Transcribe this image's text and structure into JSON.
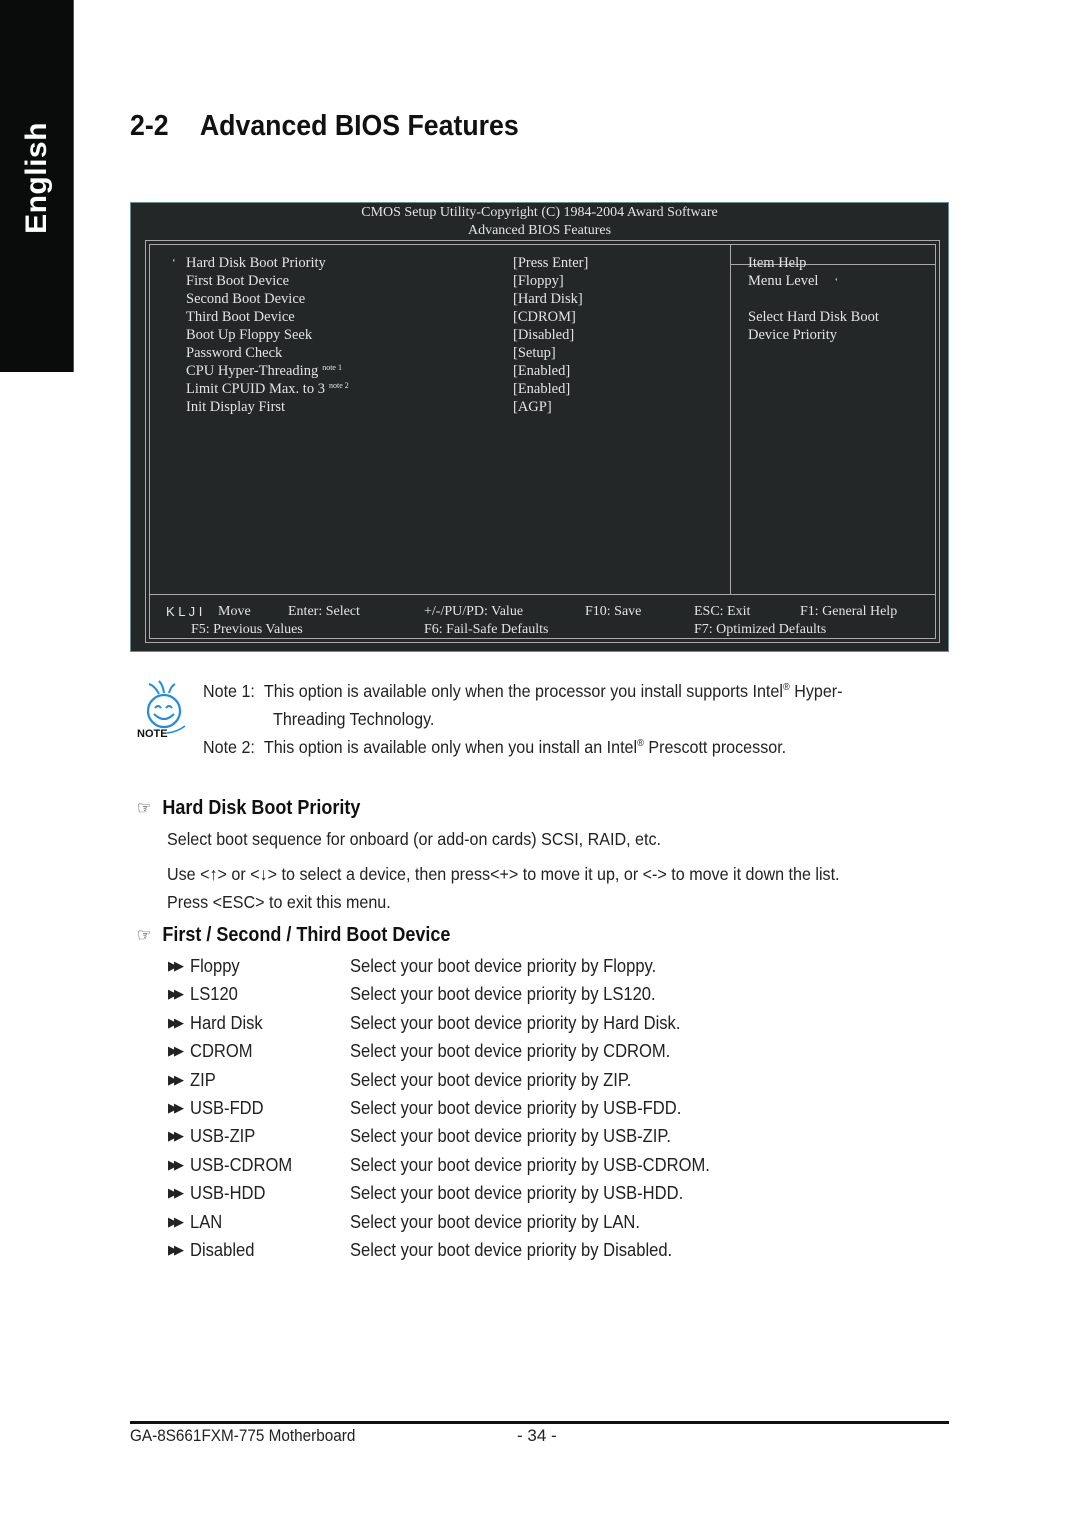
{
  "side_tab": {
    "label": "English"
  },
  "section": {
    "number": "2-2",
    "title": "Advanced BIOS Features"
  },
  "bios": {
    "header_line1": "CMOS Setup Utility-Copyright (C) 1984-2004 Award Software",
    "header_line2": "Advanced BIOS Features",
    "items": [
      {
        "marker": "‘",
        "label": "Hard Disk Boot Priority",
        "note": "",
        "value": "[Press Enter]"
      },
      {
        "marker": "",
        "label": "First Boot Device",
        "note": "",
        "value": "[Floppy]"
      },
      {
        "marker": "",
        "label": "Second Boot Device",
        "note": "",
        "value": "[Hard Disk]"
      },
      {
        "marker": "",
        "label": "Third Boot Device",
        "note": "",
        "value": "[CDROM]"
      },
      {
        "marker": "",
        "label": "Boot Up Floppy Seek",
        "note": "",
        "value": "[Disabled]"
      },
      {
        "marker": "",
        "label": "Password Check",
        "note": "",
        "value": "[Setup]"
      },
      {
        "marker": "",
        "label": "CPU  Hyper-Threading",
        "note": "note 1",
        "value": "[Enabled]"
      },
      {
        "marker": "",
        "label": "Limit CPUID Max. to 3",
        "note": "note 2",
        "value": "[Enabled]"
      },
      {
        "marker": "",
        "label": "Init Display First",
        "note": "",
        "value": "[AGP]"
      }
    ],
    "help": {
      "title": "Item Help",
      "menu_level": "Menu Level",
      "menu_level_marker": "‘",
      "line1": "Select Hard Disk Boot",
      "line2": "Device  Priority"
    },
    "keys": {
      "arrows": "K L J I",
      "move": "Move",
      "enter": "Enter: Select",
      "value": "+/-/PU/PD: Value",
      "save": "F10: Save",
      "exit": "ESC: Exit",
      "help": "F1: General Help",
      "previous": "F5: Previous Values",
      "failsafe": "F6: Fail-Safe Defaults",
      "optimized": "F7: Optimized Defaults"
    }
  },
  "notes": {
    "icon_label": "NOTE",
    "note1_prefix": "Note 1:",
    "note1_text": "This option is available only when the processor you install supports Intel",
    "note1_text_after": " Hyper-",
    "note1_cont": "Threading Technology.",
    "note2_prefix": "Note 2:",
    "note2_text": "This option is available only when you install an Intel",
    "note2_text_after": " Prescott processor.",
    "registered": "®"
  },
  "hard_disk": {
    "heading": "Hard Disk Boot Priority",
    "para1": "Select boot sequence for onboard (or add-on cards) SCSI, RAID, etc.",
    "para2": "Use <↑> or <↓> to select a device, then press<+> to move it up, or <-> to move it down the list.",
    "para3": "Press <ESC> to exit this menu."
  },
  "boot_device": {
    "heading": "First / Second / Third Boot Device",
    "options": [
      {
        "name": "Floppy",
        "desc": "Select your boot device priority by Floppy."
      },
      {
        "name": "LS120",
        "desc": "Select your boot device priority by LS120."
      },
      {
        "name": "Hard Disk",
        "desc": "Select your boot device priority by Hard Disk."
      },
      {
        "name": "CDROM",
        "desc": "Select your boot device priority by CDROM."
      },
      {
        "name": "ZIP",
        "desc": "Select your boot device priority by ZIP."
      },
      {
        "name": "USB-FDD",
        "desc": "Select your boot device priority by USB-FDD."
      },
      {
        "name": "USB-ZIP",
        "desc": "Select your boot device priority by USB-ZIP."
      },
      {
        "name": "USB-CDROM",
        "desc": "Select your boot device priority by USB-CDROM."
      },
      {
        "name": "USB-HDD",
        "desc": "Select your boot device priority by USB-HDD."
      },
      {
        "name": "LAN",
        "desc": "Select your boot device priority by LAN."
      },
      {
        "name": "Disabled",
        "desc": "Select your boot device priority by Disabled."
      }
    ]
  },
  "footer": {
    "model": "GA-8S661FXM-775 Motherboard",
    "page": "- 34 -"
  }
}
